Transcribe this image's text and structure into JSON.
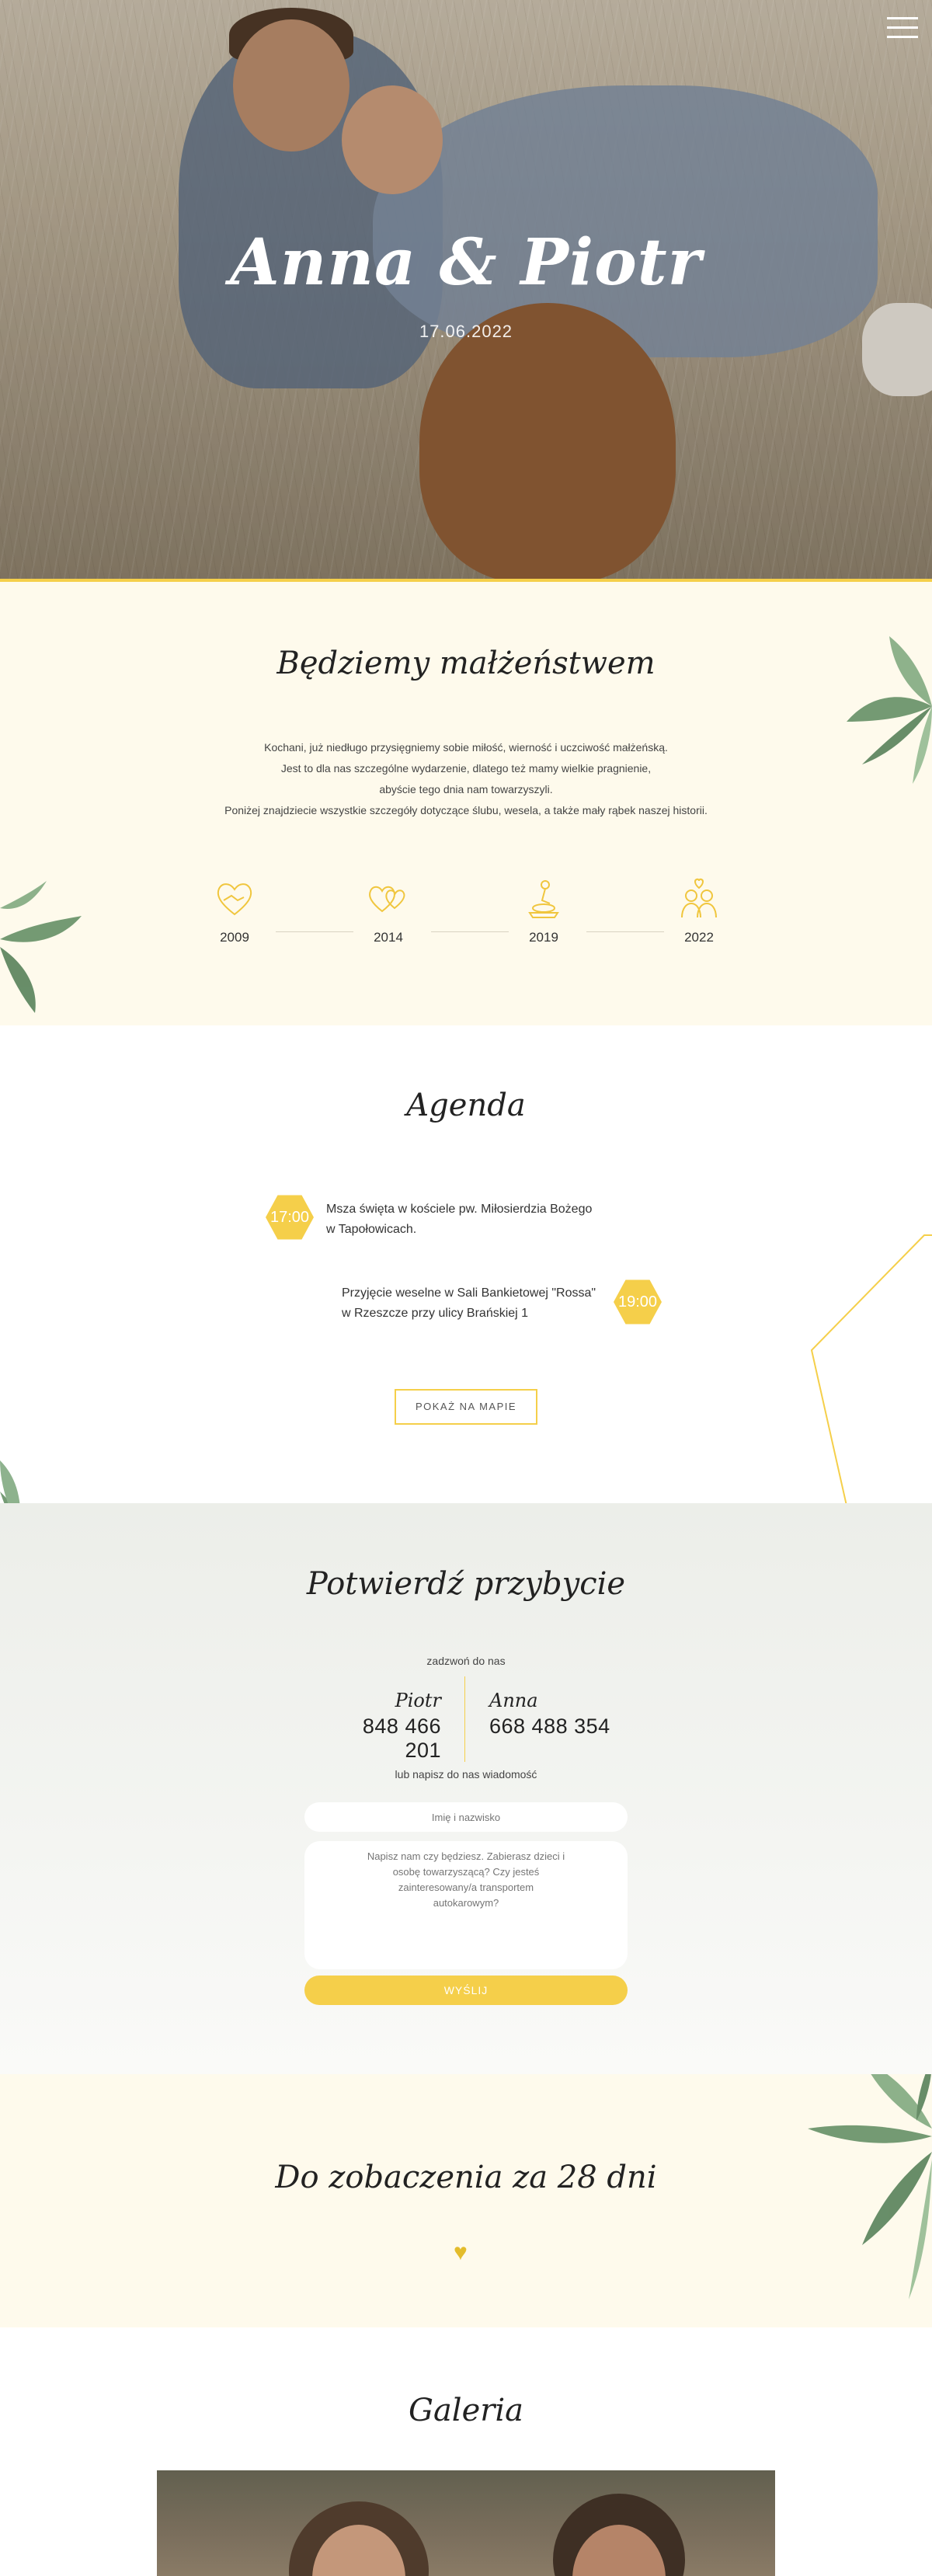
{
  "hero": {
    "title": "Anna & Piotr",
    "date": "17.06.2022"
  },
  "about": {
    "title": "Będziemy małżeństwem",
    "lines": [
      "Kochani, już niedługo przysięgniemy sobie miłość, wierność i uczciwość małżeńską.",
      "Jest to dla nas szczególne wydarzenie, dlatego też mamy wielkie pragnienie,",
      "abyście tego dnia nam towarzyszyli.",
      "Poniżej znajdziecie wszystkie szczegóły dotyczące ślubu, wesela, a także mały rąbek naszej historii."
    ],
    "timeline": [
      {
        "year": "2009",
        "icon": "handshake-heart-icon"
      },
      {
        "year": "2014",
        "icon": "two-hearts-icon"
      },
      {
        "year": "2019",
        "icon": "proposal-ring-icon"
      },
      {
        "year": "2022",
        "icon": "couple-icon"
      }
    ]
  },
  "agenda": {
    "title": "Agenda",
    "items": [
      {
        "time": "17:00",
        "line1": "Msza święta w kościele pw. Miłosierdzia Bożego",
        "line2": "w Tapołowicach."
      },
      {
        "time": "19:00",
        "line1": "Przyjęcie weselne w Sali Bankietowej \"Rossa\"",
        "line2": "w Rzeszcze przy ulicy Brańskiej 1"
      }
    ],
    "map_button": "POKAŻ NA MAPIE"
  },
  "rsvp": {
    "title": "Potwierdź przybycie",
    "call_label": "zadzwoń do nas",
    "contacts": [
      {
        "name": "Piotr",
        "phone": "848 466 201"
      },
      {
        "name": "Anna",
        "phone": "668 488 354"
      }
    ],
    "write_label": "lub napisz do nas wiadomość",
    "name_placeholder": "Imię i nazwisko",
    "message_placeholder": "Napisz nam czy będziesz. Zabierasz dzieci i osobę towarzyszącą? Czy jesteś zainteresowany/a transportem autokarowym?",
    "send_label": "WYŚLIJ"
  },
  "countdown": {
    "title": "Do zobaczenia za 28 dni"
  },
  "gallery": {
    "title": "Galeria"
  },
  "colors": {
    "accent": "#f5cf4a",
    "cream": "#fefaec",
    "leaf": "#5d8a5e"
  }
}
